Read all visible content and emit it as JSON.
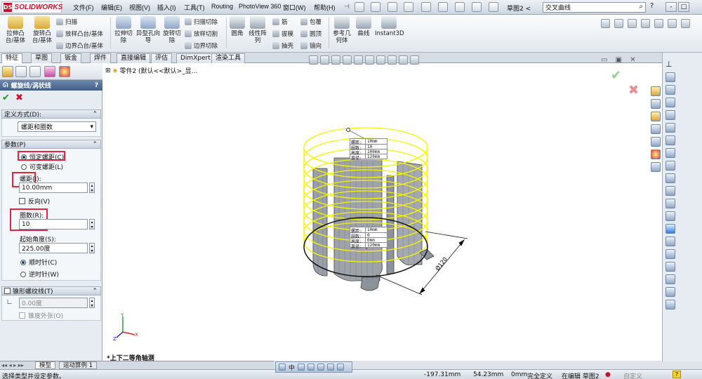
{
  "app": {
    "logo_text": "SOLIDWORKS",
    "logo_mark": "DS"
  },
  "menu": [
    "文件(F)",
    "编辑(E)",
    "视图(V)",
    "插入(I)",
    "工具(T)",
    "Routing",
    "PhotoView 360",
    "窗口(W)",
    "帮助(H)"
  ],
  "document_title": "草图2 <",
  "search": {
    "value": "交叉曲线"
  },
  "window_buttons": [
    "?",
    "-",
    "□"
  ],
  "commands": {
    "big": [
      "拉伸凸台/基体",
      "旋转凸台/基体",
      "拉伸切除",
      "异型孔向导",
      "旋转切除",
      "圆角",
      "线性阵列",
      "参考几何体",
      "曲线",
      "Instant3D"
    ],
    "small": [
      "扫描",
      "放样凸台/基体",
      "边界凸台/基体",
      "扫描切除",
      "放样切割",
      "边界切除",
      "筋",
      "拔模",
      "抽壳",
      "包覆",
      "圆顶",
      "镜向"
    ]
  },
  "tabs": [
    "特征",
    "草图",
    "钣金",
    "焊件",
    "直接编辑",
    "评估",
    "DimXpert",
    "渲染工具"
  ],
  "property_manager": {
    "title": "螺旋线/涡状线",
    "help": "?",
    "definition": {
      "header": "定义方式(D):",
      "value": "螺距和圈数"
    },
    "parameters": {
      "header": "参数(P)",
      "constant_pitch": "恒定螺距(C)",
      "variable_pitch": "可变螺距(L)",
      "pitch_label": "螺距(I):",
      "pitch_value": "10.00mm",
      "reverse": "反向(V)",
      "revolutions_label": "圈数(R):",
      "revolutions_value": "10",
      "start_angle_label": "起始角度(S):",
      "start_angle_value": "225.00度",
      "clockwise": "顺时针(C)",
      "counterclockwise": "逆时针(W)"
    },
    "taper": {
      "header": "锥形螺纹线(T)",
      "angle_value": "0.00度",
      "taper_outward": "锥度外张(O)"
    }
  },
  "feature_tree": {
    "item": "零件2 (默认<<默认>_显..."
  },
  "helix_callouts": {
    "top": [
      [
        "螺距:",
        "10mm"
      ],
      [
        "圈数:",
        "10"
      ],
      [
        "高度:",
        "100mm"
      ],
      [
        "直径:",
        "120mm"
      ]
    ],
    "bottom": [
      [
        "螺距:",
        "10mm"
      ],
      [
        "圈数:",
        "0"
      ],
      [
        "高度:",
        "0mm"
      ],
      [
        "直径:",
        "120mm"
      ]
    ]
  },
  "dimension": "Ø120",
  "view_name": "*上下二等角轴测",
  "bottom_tabs": [
    "模型",
    "运动算例 1"
  ],
  "status": {
    "prompt": "选择类型并设定参数。",
    "x": "-197.31mm",
    "y": "54.23mm",
    "z": "0mm",
    "state": "完全定义",
    "editing": "在编辑 草图2",
    "units": "自定义"
  },
  "colors": {
    "helix": "#f5f500",
    "accent_red": "#e2263a",
    "header_blue": "#3f5f8b"
  }
}
